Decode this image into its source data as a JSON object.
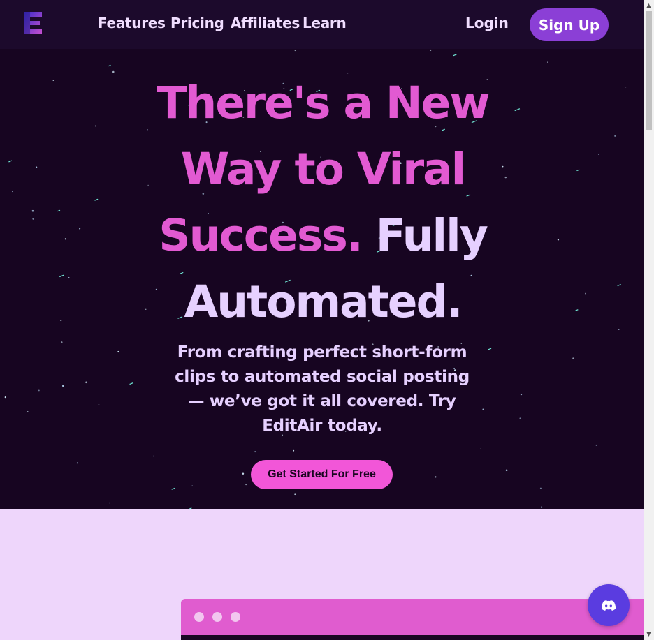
{
  "nav": {
    "links": [
      "Features",
      "Pricing",
      "Affiliates",
      "Learn"
    ],
    "login_label": "Login",
    "signup_label": "Sign Up"
  },
  "hero": {
    "headline_pink_1": "There's a New",
    "headline_pink_2": "Way to Viral",
    "headline_pink_3": "Success.",
    "headline_light_1": "Fully",
    "headline_light_2": "Automated.",
    "subtext": "From crafting perfect short-form clips to automated social posting — we’ve got it all covered. Try EditAir today.",
    "cta_label": "Get Started For Free"
  },
  "icons": {
    "logo": "editair-logo-icon",
    "discord": "discord-icon"
  },
  "colors": {
    "nav_bg": "#1c0a2c",
    "hero_bg": "#170521",
    "accent_pink": "#e25ad2",
    "accent_purple": "#8b3fd6",
    "cta_pink": "#f256d8",
    "lower_bg": "#eed6fb",
    "discord_bg": "#5a3ce0"
  }
}
